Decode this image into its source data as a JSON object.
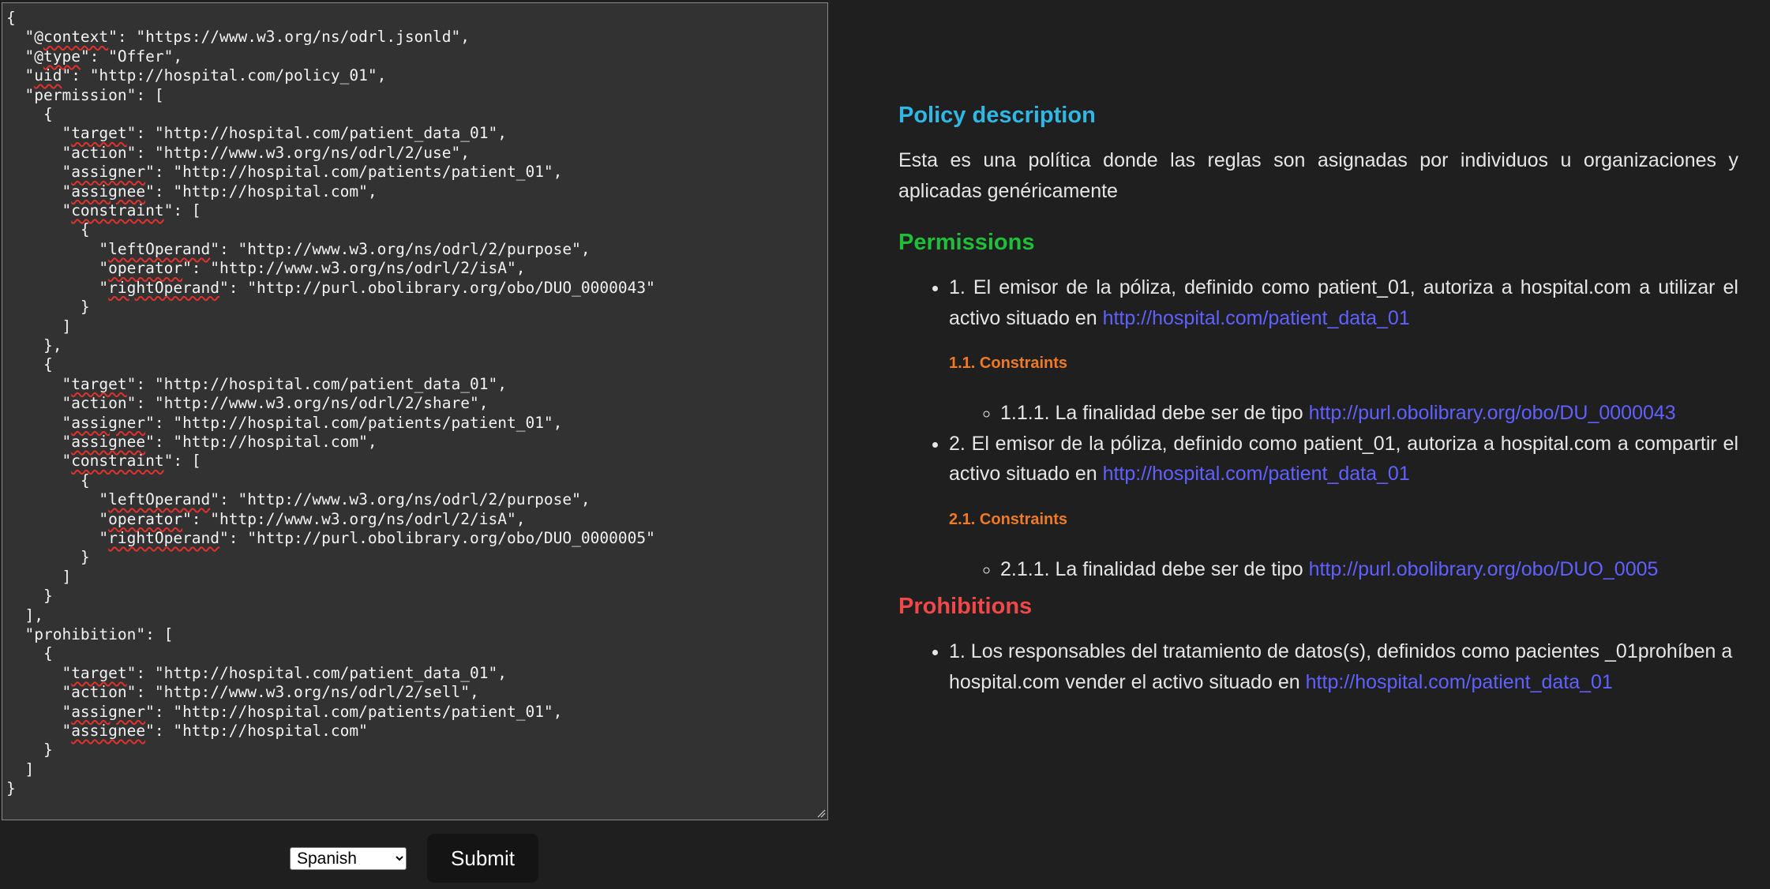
{
  "editor": {
    "lines": [
      "{",
      "  \"@context\": \"https://www.w3.org/ns/odrl.jsonld\",",
      "  \"@type\": \"Offer\",",
      "  \"uid\": \"http://hospital.com/policy_01\",",
      "  \"permission\": [",
      "    {",
      "      \"target\": \"http://hospital.com/patient_data_01\",",
      "      \"action\": \"http://www.w3.org/ns/odrl/2/use\",",
      "      \"assigner\": \"http://hospital.com/patients/patient_01\",",
      "      \"assignee\": \"http://hospital.com\",",
      "      \"constraint\": [",
      "        {",
      "          \"leftOperand\": \"http://www.w3.org/ns/odrl/2/purpose\",",
      "          \"operator\": \"http://www.w3.org/ns/odrl/2/isA\",",
      "          \"rightOperand\": \"http://purl.obolibrary.org/obo/DUO_0000043\"",
      "        }",
      "      ]",
      "    },",
      "    {",
      "      \"target\": \"http://hospital.com/patient_data_01\",",
      "      \"action\": \"http://www.w3.org/ns/odrl/2/share\",",
      "      \"assigner\": \"http://hospital.com/patients/patient_01\",",
      "      \"assignee\": \"http://hospital.com\",",
      "      \"constraint\": [",
      "        {",
      "          \"leftOperand\": \"http://www.w3.org/ns/odrl/2/purpose\",",
      "          \"operator\": \"http://www.w3.org/ns/odrl/2/isA\",",
      "          \"rightOperand\": \"http://purl.obolibrary.org/obo/DUO_0000005\"",
      "        }",
      "      ]",
      "    }",
      "  ],",
      "  \"prohibition\": [",
      "    {",
      "      \"target\": \"http://hospital.com/patient_data_01\",",
      "      \"action\": \"http://www.w3.org/ns/odrl/2/sell\",",
      "      \"assigner\": \"http://hospital.com/patients/patient_01\",",
      "      \"assignee\": \"http://hospital.com\"",
      "    }",
      "  ]",
      "}"
    ],
    "spellcheck_words": [
      "context",
      "type",
      "uid",
      "target",
      "assigner",
      "assignee",
      "constraint",
      "leftOperand",
      "operator",
      "rightOperand"
    ]
  },
  "controls": {
    "language": "Spanish",
    "submit_label": "Submit"
  },
  "colors": {
    "background": "#1f1f1f",
    "editor_bg": "#323232",
    "policy_heading": "#2fb7e6",
    "permissions_heading": "#1fbf3a",
    "prohibitions_heading": "#f04848",
    "constraints_heading": "#ef7a24",
    "link": "#6060ff"
  },
  "policy": {
    "heading": "Policy description",
    "description": "Esta es una política donde las reglas son asignadas por individuos u organizaciones y aplicadas genéricamente"
  },
  "permissions": {
    "heading": "Permissions",
    "items": [
      {
        "text": "1. El emisor de la póliza, definido como patient_01, autoriza a hospital.com a utilizar el activo situado en ",
        "link": "http://hospital.com/patient_data_01",
        "constraints_heading": "1.1. Constraints",
        "constraints": [
          {
            "text": "1.1.1. La finalidad debe ser de tipo ",
            "link": "http://purl.obolibrary.org/obo/DU_0000043"
          }
        ]
      },
      {
        "text": "2. El emisor de la póliza, definido como patient_01, autoriza a hospital.com a compartir el activo situado en ",
        "link": "http://hospital.com/patient_data_01",
        "constraints_heading": "2.1. Constraints",
        "constraints": [
          {
            "text": "2.1.1. La finalidad debe ser de tipo ",
            "link": "http://purl.obolibrary.org/obo/DUO_0005"
          }
        ]
      }
    ]
  },
  "prohibitions": {
    "heading": "Prohibitions",
    "items": [
      {
        "text": "1. Los responsables del tratamiento de datos(s), definidos como pacientes _01prohíben a hospital.com vender el activo situado en ",
        "link": "http://hospital.com/patient_data_01"
      }
    ]
  }
}
